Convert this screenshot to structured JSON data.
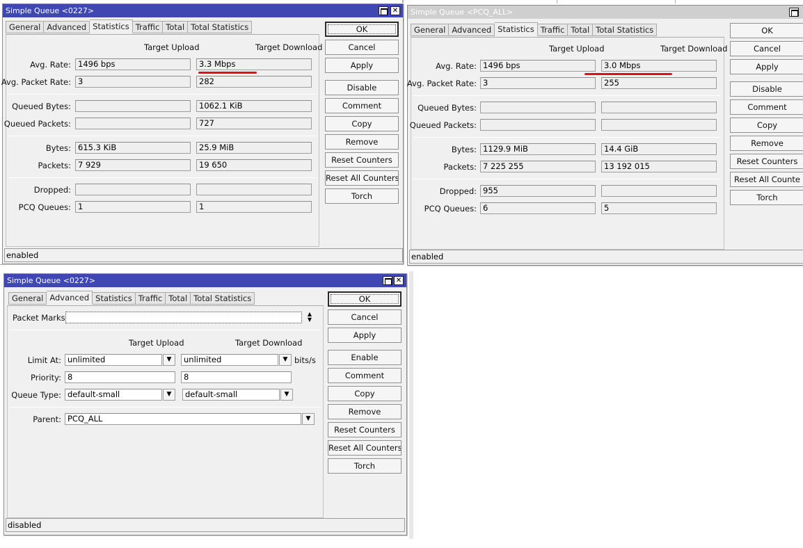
{
  "colors": {
    "active_title": "#3f48b2",
    "inactive_title": "#cfcfcf",
    "annotation": "#e01010"
  },
  "icons": {
    "maximize": "maximize-icon",
    "close": "close-icon",
    "dropdown": "dropdown-arrow-icon",
    "updown": "updown-arrows-icon"
  },
  "w1": {
    "title": "Simple Queue <0227>",
    "tabs": [
      "General",
      "Advanced",
      "Statistics",
      "Traffic",
      "Total",
      "Total Statistics"
    ],
    "col_upload": "Target Upload",
    "col_download": "Target Download",
    "labels": {
      "avg_rate": "Avg. Rate:",
      "avg_packet_rate": "Avg. Packet Rate:",
      "queued_bytes": "Queued Bytes:",
      "queued_packets": "Queued Packets:",
      "bytes": "Bytes:",
      "packets": "Packets:",
      "dropped": "Dropped:",
      "pcq_queues": "PCQ Queues:"
    },
    "values": {
      "avg_rate_up": "1496 bps",
      "avg_rate_down": "3.3 Mbps",
      "avg_packet_rate_up": "3",
      "avg_packet_rate_down": "282",
      "queued_bytes_up": "",
      "queued_bytes_down": "1062.1 KiB",
      "queued_packets_up": "",
      "queued_packets_down": "727",
      "bytes_up": "615.3 KiB",
      "bytes_down": "25.9 MiB",
      "packets_up": "7 929",
      "packets_down": "19 650",
      "dropped_up": "",
      "dropped_down": "",
      "pcq_up": "1",
      "pcq_down": "1"
    },
    "buttons": [
      "OK",
      "Cancel",
      "Apply",
      "Disable",
      "Comment",
      "Copy",
      "Remove",
      "Reset Counters",
      "Reset All Counters",
      "Torch"
    ],
    "status": "enabled"
  },
  "w2": {
    "title": "Simple Queue <PCQ_ALL>",
    "tabs": [
      "General",
      "Advanced",
      "Statistics",
      "Traffic",
      "Total",
      "Total Statistics"
    ],
    "col_upload": "Target Upload",
    "col_download": "Target Download",
    "labels": {
      "avg_rate": "Avg. Rate:",
      "avg_packet_rate": "Avg. Packet Rate:",
      "queued_bytes": "Queued Bytes:",
      "queued_packets": "Queued Packets:",
      "bytes": "Bytes:",
      "packets": "Packets:",
      "dropped": "Dropped:",
      "pcq_queues": "PCQ Queues:"
    },
    "values": {
      "avg_rate_up": "1496 bps",
      "avg_rate_down": "3.0 Mbps",
      "avg_packet_rate_up": "3",
      "avg_packet_rate_down": "255",
      "queued_bytes_up": "",
      "queued_bytes_down": "",
      "queued_packets_up": "",
      "queued_packets_down": "",
      "bytes_up": "1129.9 MiB",
      "bytes_down": "14.4 GiB",
      "packets_up": "7 225 255",
      "packets_down": "13 192 015",
      "dropped_up": "955",
      "dropped_down": "",
      "pcq_up": "6",
      "pcq_down": "5"
    },
    "buttons": [
      "OK",
      "Cancel",
      "Apply",
      "Disable",
      "Comment",
      "Copy",
      "Remove",
      "Reset Counters",
      "Reset All Counte",
      "Torch"
    ],
    "status": "enabled"
  },
  "w3": {
    "title": "Simple Queue <0227>",
    "tabs": [
      "General",
      "Advanced",
      "Statistics",
      "Traffic",
      "Total",
      "Total Statistics"
    ],
    "packet_marks_label": "Packet Marks:",
    "packet_marks_value": "",
    "col_upload": "Target Upload",
    "col_download": "Target Download",
    "labels": {
      "limit_at": "Limit At:",
      "priority": "Priority:",
      "queue_type": "Queue Type:",
      "parent": "Parent:"
    },
    "values": {
      "limit_at_up": "unlimited",
      "limit_at_down": "unlimited",
      "limit_unit": "bits/s",
      "priority_up": "8",
      "priority_down": "8",
      "queue_type_up": "default-small",
      "queue_type_down": "default-small",
      "parent": "PCQ_ALL"
    },
    "buttons": [
      "OK",
      "Cancel",
      "Apply",
      "Enable",
      "Comment",
      "Copy",
      "Remove",
      "Reset Counters",
      "Reset All Counters",
      "Torch"
    ],
    "status": "disabled"
  }
}
